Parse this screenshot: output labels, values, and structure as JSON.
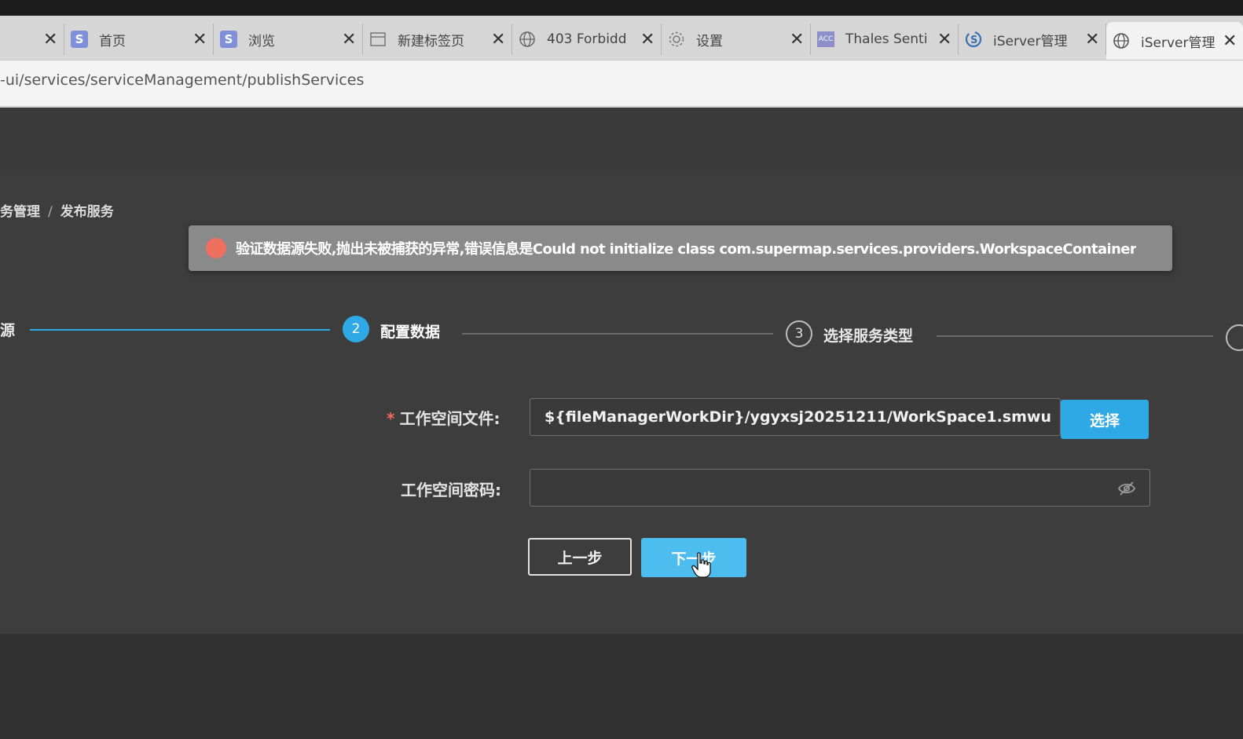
{
  "browser": {
    "tabs": [
      {
        "label": "",
        "icon": "none",
        "close": "✕"
      },
      {
        "label": "首页",
        "icon": "s-logo-icon",
        "close": "✕"
      },
      {
        "label": "浏览",
        "icon": "s-logo-icon",
        "close": "✕"
      },
      {
        "label": "新建标签页",
        "icon": "new-tab-icon",
        "close": "✕"
      },
      {
        "label": "403 Forbidd",
        "icon": "globe-icon",
        "close": "✕"
      },
      {
        "label": "设置",
        "icon": "gear-icon",
        "close": "✕"
      },
      {
        "label": "Thales Senti",
        "icon": "acc-icon",
        "close": "✕"
      },
      {
        "label": "iServer管理",
        "icon": "iserver-logo-icon",
        "close": "✕"
      },
      {
        "label": "iServer管理",
        "icon": "globe-icon",
        "close": "✕",
        "active": true
      }
    ],
    "url": "-ui/services/serviceManagement/publishServices",
    "acc_icon_text": "ACC"
  },
  "breadcrumb": {
    "parent": "务管理",
    "separator": "/",
    "current": "发布服务"
  },
  "alert": {
    "message": "验证数据源失败,抛出未被捕获的异常,错误信息是Could not initialize class com.supermap.services.providers.WorkspaceContainer",
    "color": "#f07060"
  },
  "steps": [
    {
      "number": "",
      "label": "源",
      "state": "done"
    },
    {
      "number": "2",
      "label": "配置数据",
      "state": "active"
    },
    {
      "number": "3",
      "label": "选择服务类型",
      "state": "pending"
    }
  ],
  "form": {
    "workspace_file": {
      "required_mark": "*",
      "label": "工作空间文件:",
      "value": "${fileManagerWorkDir}/ygyxsj20251211/WorkSpace1.smwu",
      "select_button": "选择"
    },
    "workspace_password": {
      "label": "工作空间密码:",
      "value": "",
      "visibility_icon": "eye-off-icon"
    }
  },
  "buttons": {
    "prev": "上一步",
    "next": "下一步"
  },
  "colors": {
    "accent": "#2fa9e6",
    "next_button": "#4dbdf0",
    "alert_background": "#8a8a8a"
  }
}
